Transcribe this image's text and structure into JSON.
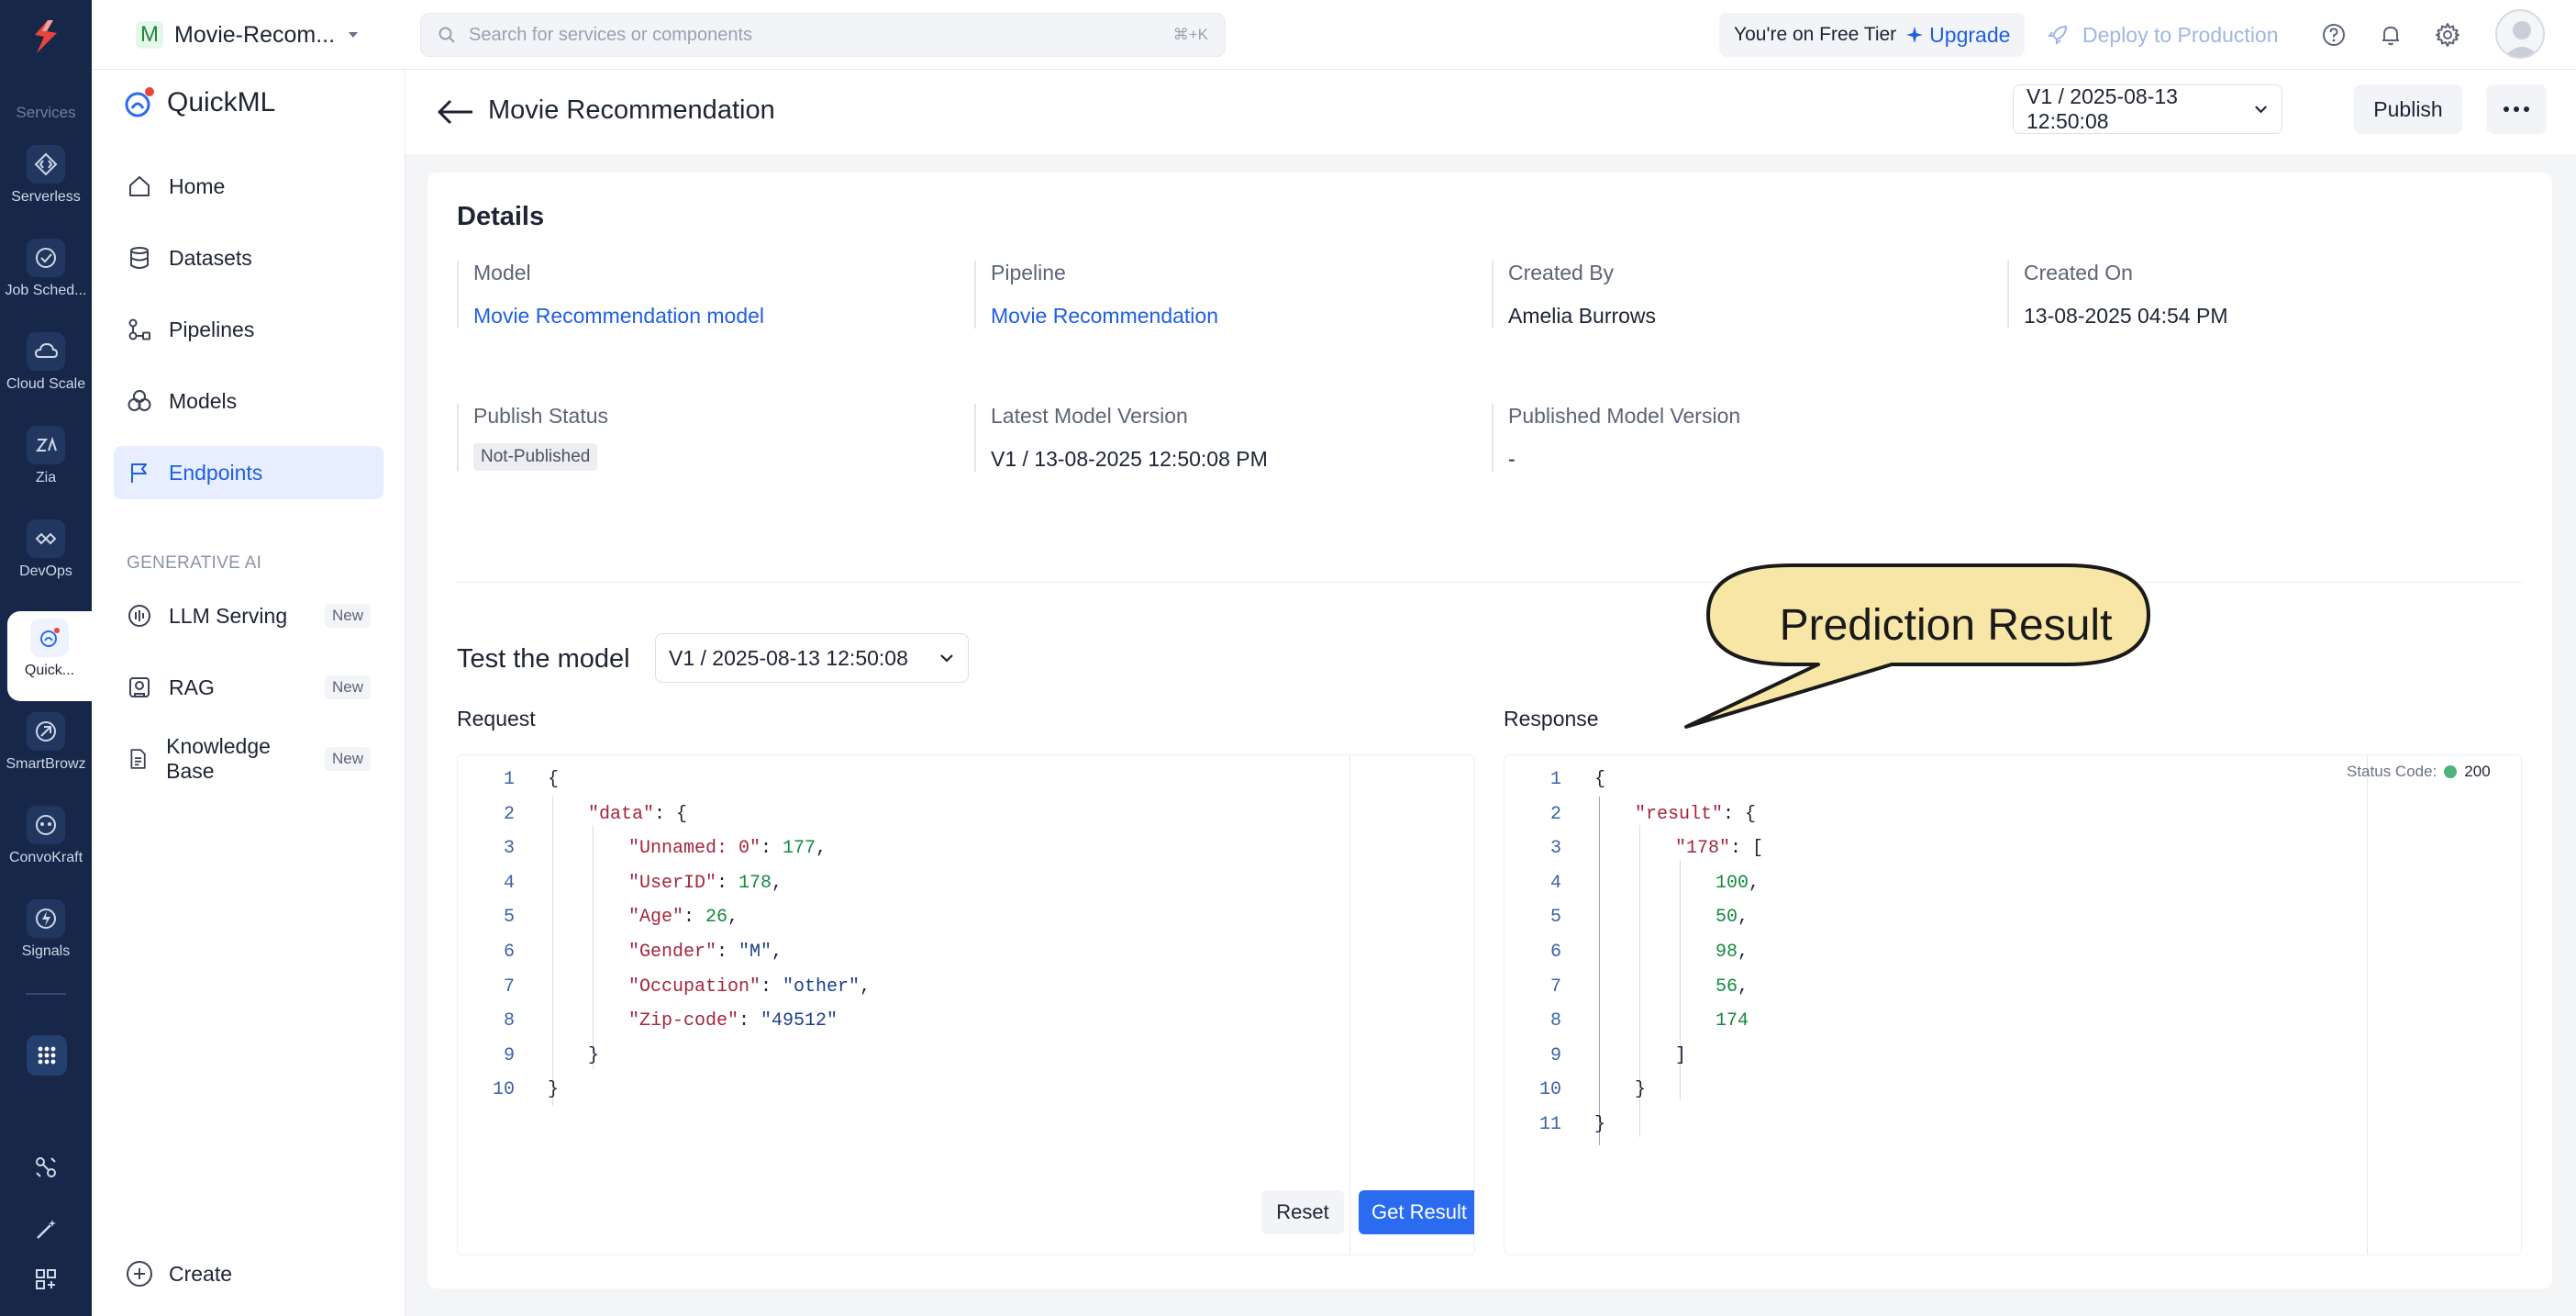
{
  "rail": {
    "heading": "Services",
    "items": [
      {
        "label": "Serverless",
        "icon": "serverless-icon"
      },
      {
        "label": "Job Sched...",
        "icon": "job-scheduling-icon"
      },
      {
        "label": "Cloud Scale",
        "icon": "cloud-scale-icon"
      },
      {
        "label": "Zia",
        "icon": "zia-icon"
      },
      {
        "label": "DevOps",
        "icon": "devops-icon"
      },
      {
        "label": "Quick...",
        "icon": "quickml-icon"
      },
      {
        "label": "SmartBrowz",
        "icon": "smartbrowz-icon"
      },
      {
        "label": "ConvoKraft",
        "icon": "convokraft-icon"
      },
      {
        "label": "Signals",
        "icon": "signals-icon"
      }
    ]
  },
  "topbar": {
    "project_initial": "M",
    "project_name": "Movie-Recom...",
    "search_placeholder": "Search for services or components",
    "search_shortcut": "⌘+K",
    "tier_text": "You're on Free Tier",
    "upgrade_label": "Upgrade",
    "deploy_label": "Deploy to Production"
  },
  "sidebar": {
    "brand": "QuickML",
    "items": [
      {
        "label": "Home"
      },
      {
        "label": "Datasets"
      },
      {
        "label": "Pipelines"
      },
      {
        "label": "Models"
      },
      {
        "label": "Endpoints"
      }
    ],
    "section_label": "GENERATIVE AI",
    "gen_items": [
      {
        "label": "LLM Serving",
        "badge": "New"
      },
      {
        "label": "RAG",
        "badge": "New"
      },
      {
        "label": "Knowledge Base",
        "badge": "New"
      }
    ],
    "create_label": "Create"
  },
  "header": {
    "title": "Movie Recommendation",
    "version": "V1 / 2025-08-13 12:50:08",
    "publish_label": "Publish"
  },
  "details": {
    "title": "Details",
    "model_label": "Model",
    "model_value": "Movie Recommendation model",
    "pipeline_label": "Pipeline",
    "pipeline_value": "Movie Recommendation",
    "created_by_label": "Created By",
    "created_by_value": "Amelia Burrows",
    "created_on_label": "Created On",
    "created_on_value": "13-08-2025 04:54 PM",
    "publish_status_label": "Publish Status",
    "publish_status_value": "Not-Published",
    "latest_version_label": "Latest Model Version",
    "latest_version_value": "V1 / 13-08-2025 12:50:08 PM",
    "published_version_label": "Published Model Version",
    "published_version_value": "-"
  },
  "test": {
    "title": "Test the model",
    "version": "V1 / 2025-08-13 12:50:08",
    "request_label": "Request",
    "response_label": "Response",
    "reset_label": "Reset",
    "get_result_label": "Get Result",
    "status_code_label": "Status Code:",
    "status_code_value": "200"
  },
  "request_lines": [
    {
      "n": "1",
      "text": "{"
    },
    {
      "n": "2",
      "key": "\"data\"",
      "rest": ": {"
    },
    {
      "n": "3",
      "key": "\"Unnamed: 0\"",
      "sep": ": ",
      "num": "177",
      "rest": ","
    },
    {
      "n": "4",
      "key": "\"UserID\"",
      "sep": ": ",
      "num": "178",
      "rest": ","
    },
    {
      "n": "5",
      "key": "\"Age\"",
      "sep": ": ",
      "num": "26",
      "rest": ","
    },
    {
      "n": "6",
      "key": "\"Gender\"",
      "sep": ": ",
      "str": "\"M\"",
      "rest": ","
    },
    {
      "n": "7",
      "key": "\"Occupation\"",
      "sep": ": ",
      "str": "\"other\"",
      "rest": ","
    },
    {
      "n": "8",
      "key": "\"Zip-code\"",
      "sep": ": ",
      "str": "\"49512\""
    },
    {
      "n": "9",
      "text": "}"
    },
    {
      "n": "10",
      "text": "}"
    }
  ],
  "response_lines": [
    {
      "n": "1",
      "text": "{"
    },
    {
      "n": "2",
      "key": "\"result\"",
      "rest": ": {"
    },
    {
      "n": "3",
      "key": "\"178\"",
      "rest": ": ["
    },
    {
      "n": "4",
      "num": "100",
      "rest": ","
    },
    {
      "n": "5",
      "num": "50",
      "rest": ","
    },
    {
      "n": "6",
      "num": "98",
      "rest": ","
    },
    {
      "n": "7",
      "num": "56",
      "rest": ","
    },
    {
      "n": "8",
      "num": "174"
    },
    {
      "n": "9",
      "text": "]"
    },
    {
      "n": "10",
      "text": "}"
    },
    {
      "n": "11",
      "text": "}"
    }
  ],
  "callout": {
    "text": "Prediction Result"
  },
  "colors": {
    "rail_bg": "#16274a",
    "accent": "#1f5fe0",
    "primary_button": "#2a6bf0",
    "json_key": "#a3253b",
    "json_number": "#128a3c",
    "json_string": "#1a3e8c",
    "callout_fill": "#f8e6a6",
    "status_ok": "#4db37a"
  }
}
